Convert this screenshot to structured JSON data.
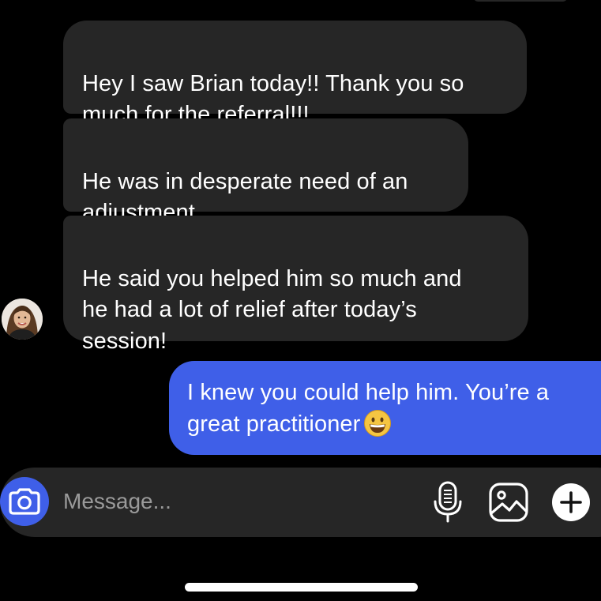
{
  "conversation": {
    "messages": [
      {
        "sender": "them",
        "text": "Hey I saw Brian today!! Thank you so\nmuch for the referral!!!"
      },
      {
        "sender": "them",
        "text": "He was in desperate need of an\nadjustment"
      },
      {
        "sender": "them",
        "text": "He said you helped him so much and\nhe had a lot of relief after today’s\nsession!"
      },
      {
        "sender": "me",
        "text": "I knew you could help him. You’re a\ngreat practitioner",
        "emoji": "grinning-face"
      }
    ]
  },
  "composer": {
    "placeholder": "Message...",
    "value": "",
    "icons": {
      "camera": "camera-icon",
      "mic": "microphone-icon",
      "gallery": "image-gallery-icon",
      "plus": "plus-icon"
    }
  },
  "colors": {
    "background": "#000000",
    "incoming_bubble": "#262626",
    "outgoing_bubble": "#3f5fe8",
    "composer": "#262626",
    "accent": "#3f5fe8"
  }
}
